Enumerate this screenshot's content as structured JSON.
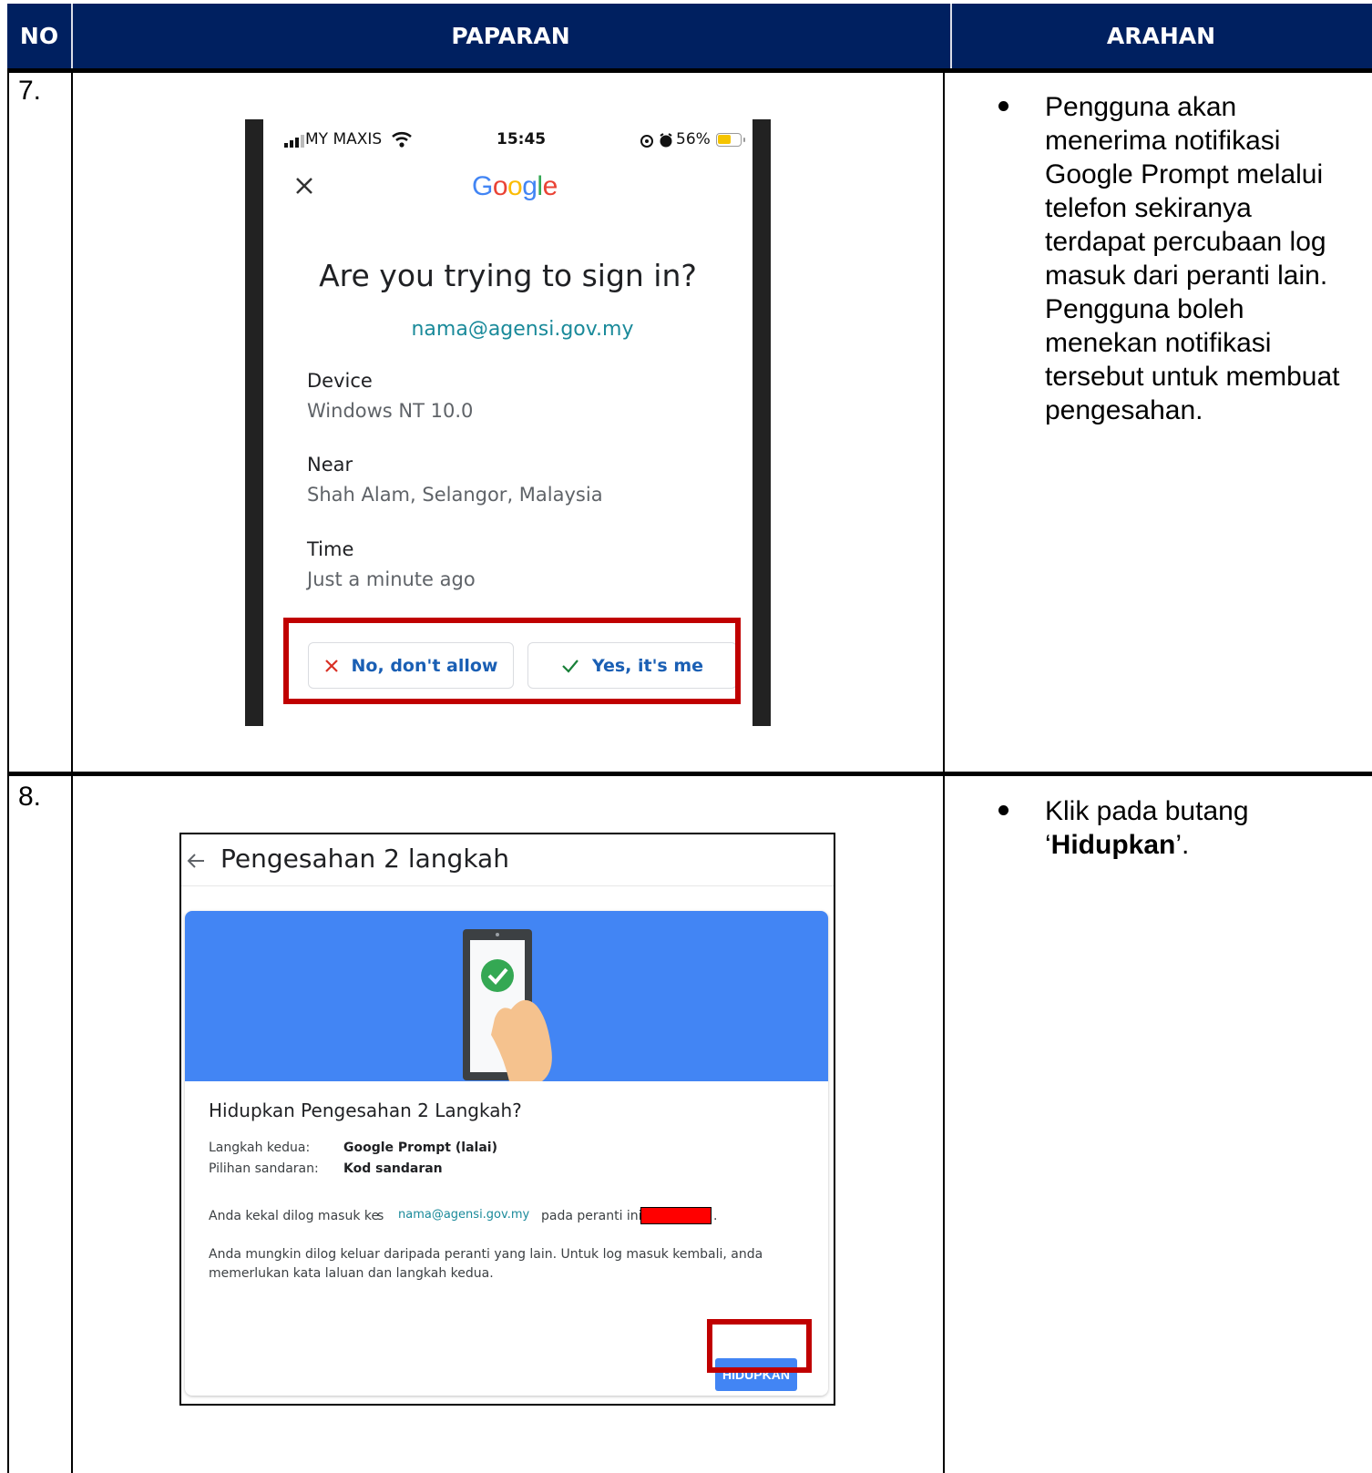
{
  "header": {
    "col_no": "NO",
    "col_paparan": "PAPARAN",
    "col_arahan": "ARAHAN"
  },
  "rows": [
    {
      "no": "7.",
      "instruction_lines": [
        "Pengguna akan",
        "menerima notifikasi",
        "Google Prompt melalui",
        "telefon sekiranya",
        "terdapat percubaan log",
        "masuk dari peranti lain.",
        "Pengguna boleh",
        "menekan notifikasi",
        "tersebut untuk membuat",
        "pengesahan."
      ],
      "phone": {
        "carrier": "MY MAXIS",
        "time": "15:45",
        "battery": "56%",
        "logo": "Google",
        "question": "Are you trying to sign in?",
        "account": "nama@agensi.gov.my",
        "device_label": "Device",
        "device_value": "Windows NT 10.0",
        "near_label": "Near",
        "near_value": "Shah Alam, Selangor, Malaysia",
        "time_label": "Time",
        "time_value": "Just a minute ago",
        "deny_button": "No, don't allow",
        "allow_button": "Yes, it's me",
        "icons": [
          "signal-icon",
          "wifi-icon",
          "alarm-icon",
          "battery-icon",
          "close-icon",
          "cross-icon",
          "check-icon"
        ]
      }
    },
    {
      "no": "8.",
      "instruction_prefix": "Klik pada butang",
      "instruction_open_quote": "‘",
      "instruction_bold": "Hidupkan",
      "instruction_close": "’.",
      "settings": {
        "page_title": "Pengesahan 2 langkah",
        "card_heading": "Hidupkan Pengesahan 2 Langkah?",
        "step_label": "Langkah kedua:",
        "step_value": "Google Prompt (lalai)",
        "backup_label": "Pilihan sandaran:",
        "backup_value": "Kod sandaran",
        "keep_text_a": "Anda kekal dilog masuk ke",
        "keep_text_s": "s",
        "keep_email": "nama@agensi.gov.my",
        "keep_text_b": "pada peranti ini:",
        "keep_text_end": ".",
        "note_line1": "Anda mungkin dilog keluar daripada peranti yang lain. Untuk log masuk kembali, anda",
        "note_line2": "memerlukan kata laluan dan langkah kedua.",
        "button_label": "HIDUPKAN",
        "banner_color": "#4285f4",
        "icons": [
          "back-arrow-icon",
          "phone-check-icon"
        ]
      }
    }
  ],
  "colors": {
    "header_bg": "#002060",
    "highlight": "#c00000",
    "redaction": "#ff0000"
  }
}
